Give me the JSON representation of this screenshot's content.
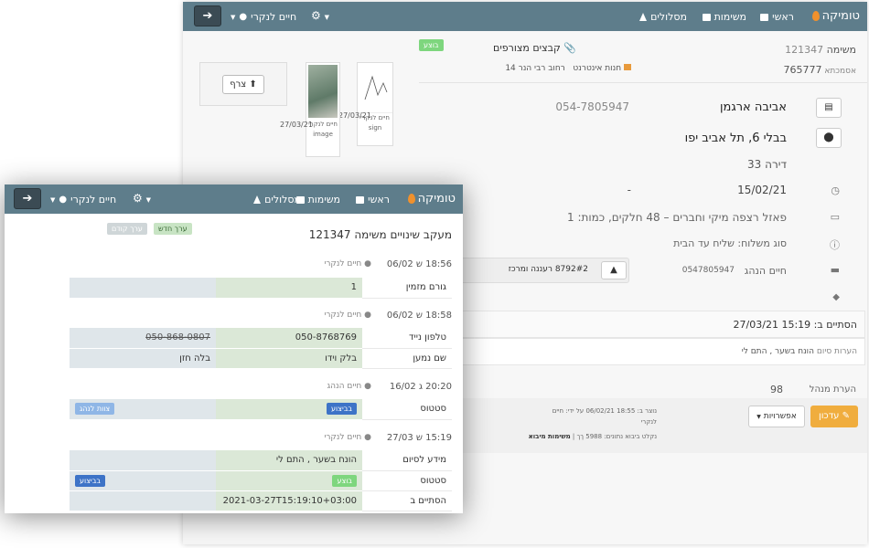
{
  "app": {
    "brand": "טומיקה"
  },
  "nav": {
    "home": "ראשי",
    "tasks": "משימות",
    "routes": "מסלולים",
    "user": "חיים לנקרי"
  },
  "task": {
    "status": "בוצע",
    "task_label": "משימה",
    "task_number": "121347",
    "shipment_label": "אסמכתא",
    "shipment_number": "765777",
    "store_label": "חנות אינטרנט",
    "address_short": "רחוב רבי הנר 14",
    "attachments_title": "קבצים מצורפים",
    "attach_button": "צרף",
    "files": [
      {
        "date": "27/03/21",
        "by": "חיים לנקרי",
        "type": "sign"
      },
      {
        "date": "27/03/21",
        "by": "חיים לנקרי",
        "type": "image"
      }
    ],
    "customer_name": "אביבה ארגמן",
    "customer_phone": "054-7805947",
    "address": "בבלי 6, תל אביב יפו",
    "apartment": "דירה 33",
    "date": "15/02/21",
    "date_dash": "-",
    "items": "פאזל רצפה מיקי וחברים – 48 חלקים, כמות: 1",
    "shipping_type": "סוג משלוח: שליח עד הבית",
    "driver": "חיים הנהג",
    "driver_phone": "0547805947",
    "route": "8792#2 רעננה ומרכז",
    "route_tag": "פ",
    "completed_label": "הסתיים ב:",
    "completed_at": "15:19 27/03/21",
    "completion_note_label": "הערות סיום",
    "completion_note": "הונח בשער , התם לי",
    "manager_note_label": "הערת מנהל",
    "manager_note": "98",
    "edit_button": "עדכון",
    "options_button": "אפשרויות",
    "created_by_label": "נוצר ב:",
    "created_at": "18:55 06/02/21",
    "created_by_text": "על ידי: חיים",
    "created_by_name": "לנקרי",
    "import_label": "נקלט ביבוא נתונים:",
    "import_id": "5988 ךך",
    "import_link": "משימות מיבוא"
  },
  "history": {
    "title": "מעקב שינויים משימה 121347",
    "legend_new": "ערך חדש",
    "legend_old": "ערך קודם",
    "entries": [
      {
        "time": "18:56 ש 06/02",
        "user": "חיים לנקרי",
        "rows": [
          {
            "label": "גורם מזמין",
            "new": "1",
            "old": ""
          }
        ]
      },
      {
        "time": "18:58 ש 06/02",
        "user": "חיים לנקרי",
        "rows": [
          {
            "label": "טלפון נייד",
            "new": "050-8768769",
            "old": "050-868-0807"
          },
          {
            "label": "שם נמען",
            "new": "בלק וידו",
            "old": "בלה חזן"
          }
        ]
      },
      {
        "time": "20:20 ג 16/02",
        "user": "חיים הנהג",
        "rows": [
          {
            "label": "סטטוס",
            "new": "בביצוע",
            "old": "צוות לנהג"
          }
        ]
      },
      {
        "time": "15:19 ש 27/03",
        "user": "חיים לנקרי",
        "rows": [
          {
            "label": "מידע לסיום",
            "new": "הונח בשער , התם לי",
            "old": ""
          },
          {
            "label": "סטטוס",
            "new": "בוצע",
            "old": "בביצוע"
          },
          {
            "label": "הסתיים ב",
            "new": "2021-03-27T15:19:10+03:00",
            "old": ""
          }
        ]
      }
    ]
  }
}
